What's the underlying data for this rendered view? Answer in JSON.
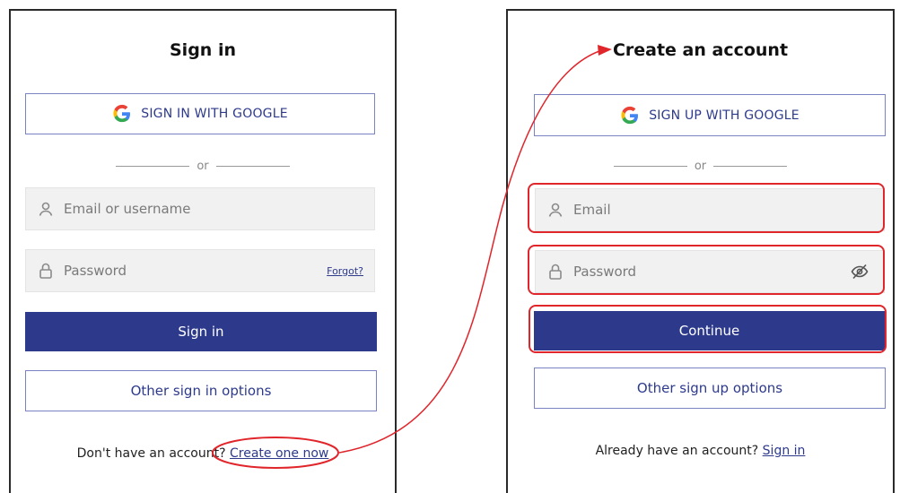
{
  "sign_in": {
    "title": "Sign in",
    "google_button": "SIGN IN WITH GOOGLE",
    "or_text": "or",
    "email_placeholder": "Email or username",
    "password_placeholder": "Password",
    "forgot_link": "Forgot?",
    "submit_button": "Sign in",
    "other_options_button": "Other sign in options",
    "footer_text": "Don't have an account?",
    "footer_link": "Create one now"
  },
  "sign_up": {
    "title": "Create an account",
    "google_button": "SIGN UP WITH GOOGLE",
    "or_text": "or",
    "email_placeholder": "Email",
    "password_placeholder": "Password",
    "submit_button": "Continue",
    "other_options_button": "Other sign up options",
    "footer_text": "Already have an account?",
    "footer_link": "Sign in"
  },
  "colors": {
    "primary": "#2d3a8c",
    "annotation": "#e0252b"
  },
  "icons": {
    "google": "google-g-icon",
    "user": "user-icon",
    "lock": "lock-icon",
    "eye_off": "eye-off-icon",
    "arrow": "arrowhead-icon"
  }
}
